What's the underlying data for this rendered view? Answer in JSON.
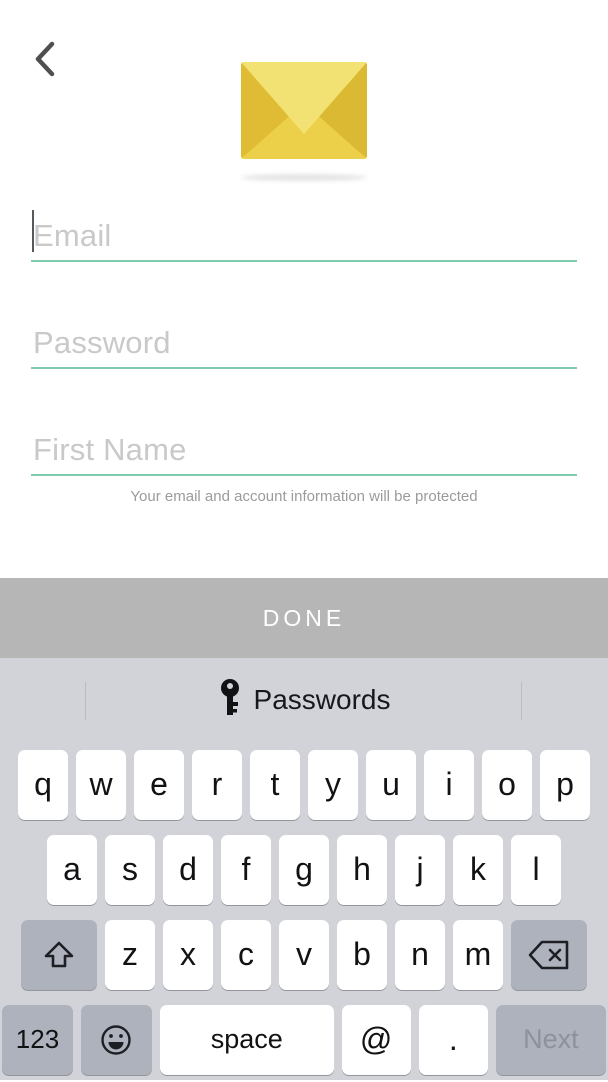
{
  "screen": {
    "name": "signup-screen",
    "background": "#ffffff"
  },
  "header": {
    "back_icon": "chevron-left-icon",
    "illustration_icon": "envelope-icon"
  },
  "colors": {
    "field_underline": "#7fcdae",
    "envelope_flap": "#f2e274",
    "envelope_left": "#dfbc34",
    "envelope_right": "#dcb932",
    "envelope_body": "#ecd049",
    "done_bar": "#b6b6b6",
    "keyboard_background": "#d1d3d9",
    "key_white": "#ffffff",
    "key_gray": "#aeb2bc",
    "placeholder_text": "#c9c9c9",
    "helper_text": "#9b9b9b",
    "next_key_text": "#8d919c"
  },
  "form": {
    "fields": [
      {
        "name": "email-field",
        "placeholder": "Email",
        "value": "",
        "focused": true
      },
      {
        "name": "password-field",
        "placeholder": "Password",
        "value": "",
        "focused": false
      },
      {
        "name": "first-name-field",
        "placeholder": "First Name",
        "value": "",
        "focused": false
      }
    ],
    "helper_text": "Your email and account information will be protected"
  },
  "toolbar": {
    "done_label": "DONE"
  },
  "keyboard": {
    "autofill": {
      "icon": "key-icon",
      "label": "Passwords"
    },
    "row1": [
      "q",
      "w",
      "e",
      "r",
      "t",
      "y",
      "u",
      "i",
      "o",
      "p"
    ],
    "row2": [
      "a",
      "s",
      "d",
      "f",
      "g",
      "h",
      "j",
      "k",
      "l"
    ],
    "row3_letters": [
      "z",
      "x",
      "c",
      "v",
      "b",
      "n",
      "m"
    ],
    "shift_icon": "shift-icon",
    "backspace_icon": "backspace-icon",
    "numbers_label": "123",
    "emoji_icon": "emoji-smiley-icon",
    "space_label": "space",
    "at_label": "@",
    "period_label": ".",
    "next_label": "Next"
  }
}
